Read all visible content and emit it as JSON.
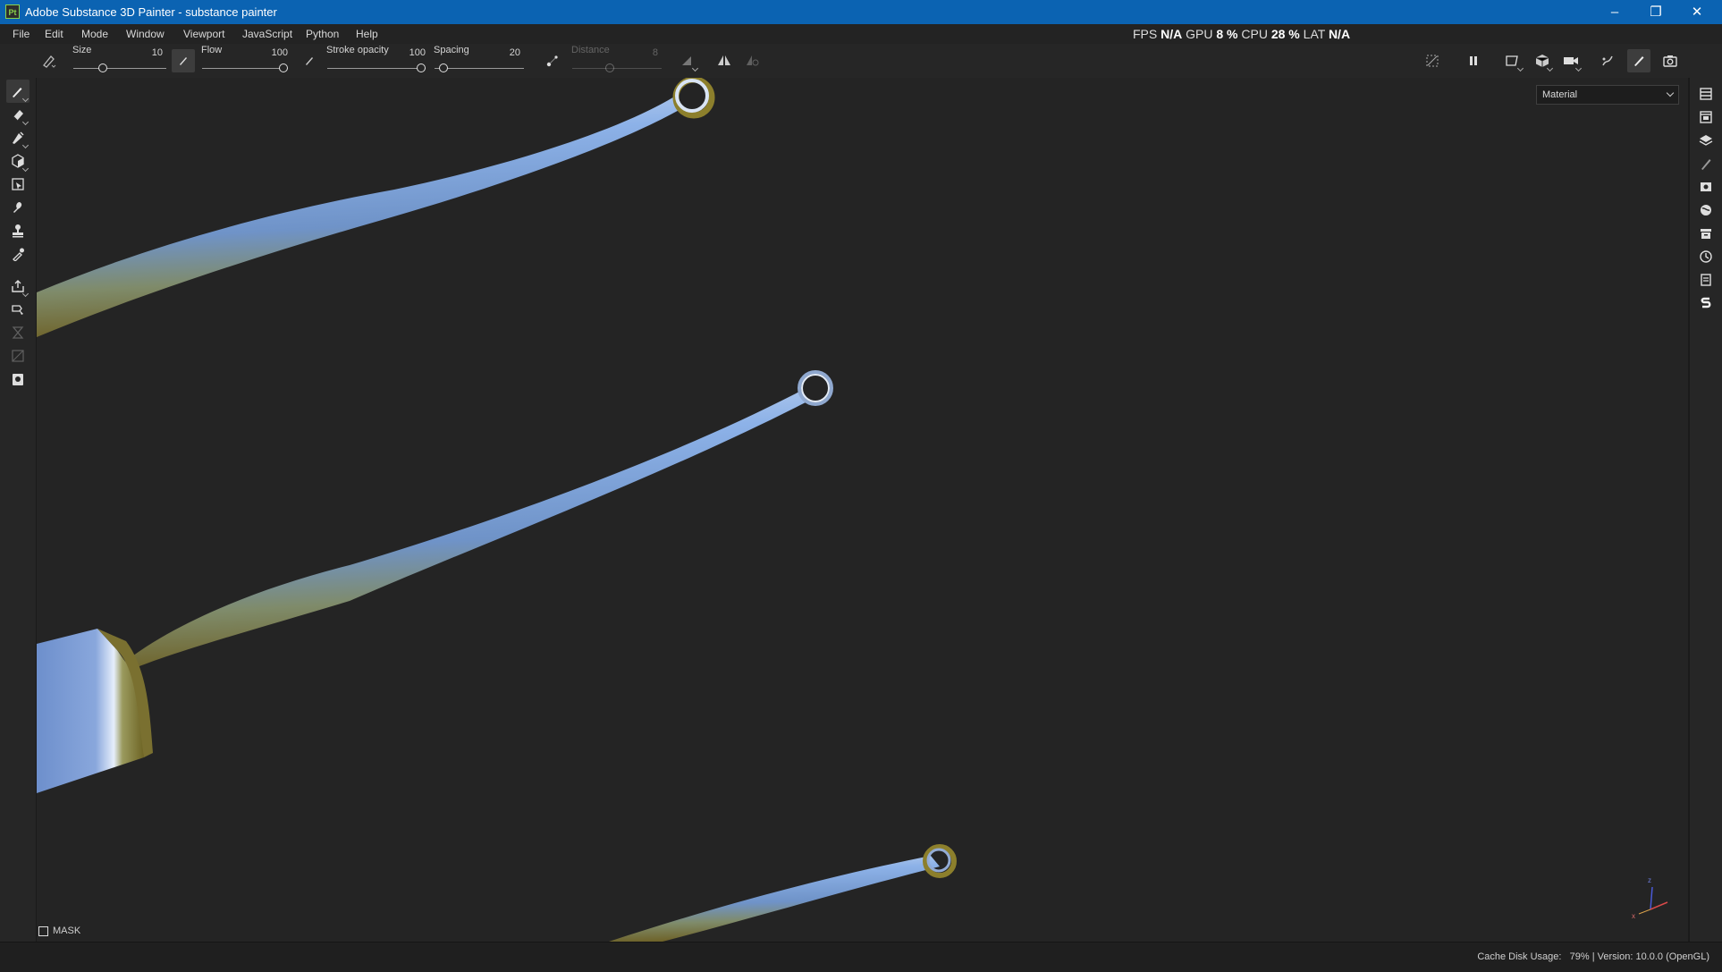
{
  "window": {
    "app_icon": "Pt",
    "title": "Adobe Substance 3D Painter - substance painter",
    "controls": [
      "minimize-icon",
      "restore-icon",
      "close-icon"
    ]
  },
  "menu": {
    "items": [
      "File",
      "Edit",
      "Mode",
      "Window",
      "Viewport",
      "JavaScript",
      "Python",
      "Help"
    ]
  },
  "performance": {
    "fps_label": "FPS",
    "fps_value": "N/A",
    "gpu_label": "GPU",
    "gpu_value": "8 %",
    "cpu_label": "CPU",
    "cpu_value": "28 %",
    "lat_label": "LAT",
    "lat_value": "N/A"
  },
  "toolbar": {
    "size": {
      "label": "Size",
      "value": "10"
    },
    "flow": {
      "label": "Flow",
      "value": "100"
    },
    "stroke_opacity": {
      "label": "Stroke opacity",
      "value": "100"
    },
    "spacing": {
      "label": "Spacing",
      "value": "20"
    },
    "distance": {
      "label": "Distance",
      "value": "8"
    }
  },
  "left_tools": [
    "paint-brush-icon",
    "eraser-icon",
    "projection-icon",
    "polygon-fill-icon",
    "geometry-mask-icon",
    "smudge-icon",
    "clone-stamp-icon",
    "color-picker-icon",
    "bake-icon",
    "select-icon",
    "hourglass-icon",
    "uv-icon",
    "screenshot-icon"
  ],
  "right_panels": [
    "layers-list-icon",
    "texture-set-icon",
    "layer-stack-icon",
    "properties-icon",
    "display-settings-icon",
    "environment-icon",
    "shelf-icon",
    "history-icon",
    "log-icon",
    "substance-icon"
  ],
  "viewport": {
    "channel_select": "Material",
    "mask_label": "MASK",
    "axis_labels": {
      "z": "z",
      "x": "x"
    }
  },
  "status": {
    "cache_label": "Cache Disk Usage:",
    "cache_value": "79%",
    "version": "| Version: 10.0.0 (OpenGL)"
  },
  "colors": {
    "titlebar": "#0b63b2",
    "metal_blue": "#7fa3d9",
    "metal_gold": "#8c7f2c",
    "viewport_bg": "#242424"
  }
}
